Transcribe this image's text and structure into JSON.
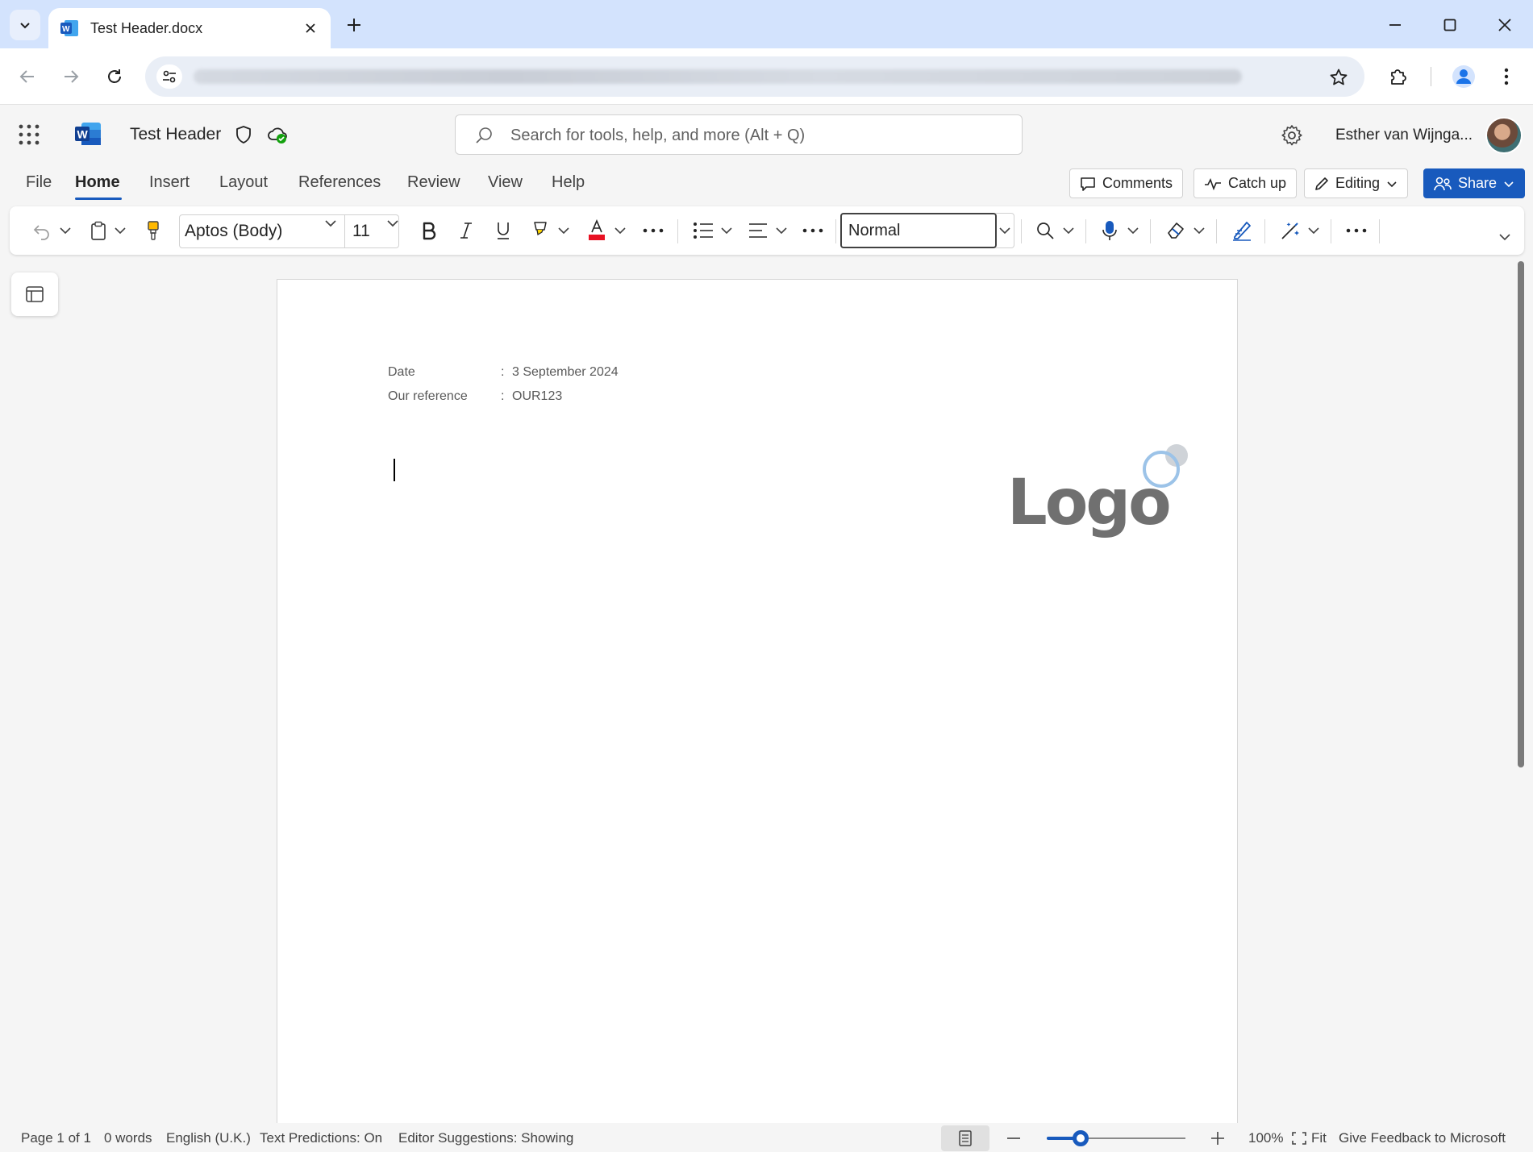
{
  "browser": {
    "tab_title": "Test Header.docx"
  },
  "app": {
    "doc_title": "Test Header",
    "search_placeholder": "Search for tools, help, and more (Alt + Q)",
    "user_name": "Esther van Wijnga..."
  },
  "ribbon": {
    "tabs": [
      "File",
      "Home",
      "Insert",
      "Layout",
      "References",
      "Review",
      "View",
      "Help"
    ],
    "active_tab": "Home",
    "actions": {
      "comments": "Comments",
      "catch_up": "Catch up",
      "editing": "Editing",
      "share": "Share"
    }
  },
  "toolbar": {
    "font_name": "Aptos (Body)",
    "font_size": "11",
    "style": "Normal",
    "font_color": "#e81123",
    "highlight_color": "#ffd700"
  },
  "document": {
    "header": {
      "date_label": "Date",
      "date_sep": ":",
      "date_value": "3 September 2024",
      "ref_label": "Our reference",
      "ref_sep": ":",
      "ref_value": "OUR123"
    },
    "logo_text": "Logo"
  },
  "status": {
    "page": "Page 1 of 1",
    "words": "0 words",
    "language": "English (U.K.)",
    "text_predictions": "Text Predictions: On",
    "editor_suggestions": "Editor Suggestions: Showing",
    "zoom": "100%",
    "fit": "Fit",
    "feedback": "Give Feedback to Microsoft"
  },
  "colors": {
    "accent": "#185abd",
    "tabbar": "#d3e3fd"
  }
}
